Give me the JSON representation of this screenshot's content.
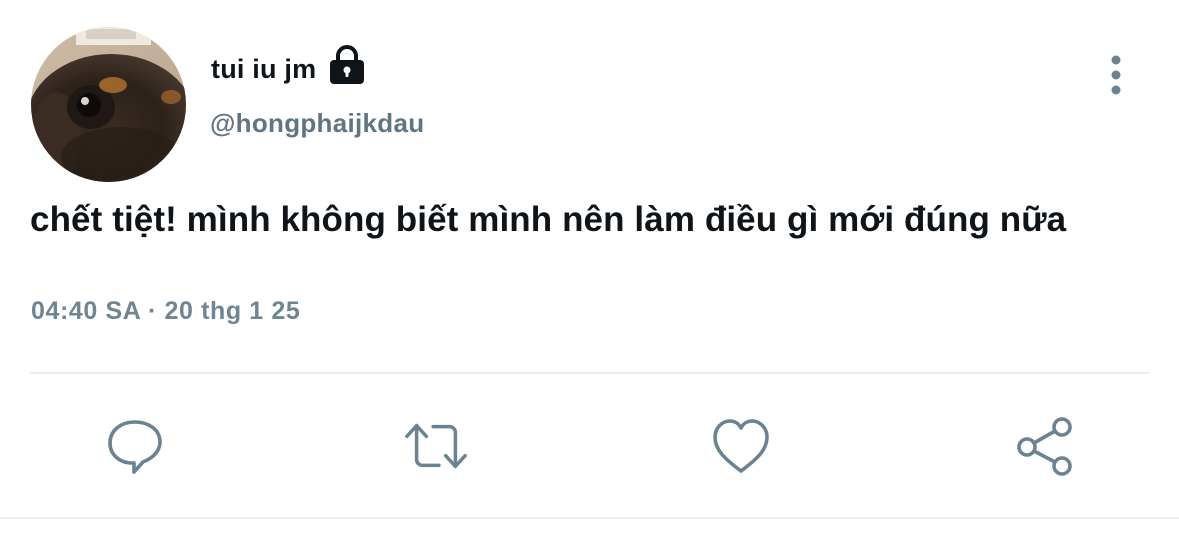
{
  "user": {
    "display_name": "tui iu jm",
    "handle": "@hongphaijkdau",
    "avatar_icon": "avatar-dog-photo",
    "locked_icon": "lock-icon"
  },
  "tweet": {
    "text": "chết tiệt! mình không biết mình nên làm điều gì mới đúng nữa",
    "time": "04:40 SA",
    "separator": "·",
    "date": "20 thg 1 25"
  },
  "actions": [
    {
      "name": "reply",
      "icon": "comment-icon"
    },
    {
      "name": "retweet",
      "icon": "retweet-icon"
    },
    {
      "name": "like",
      "icon": "heart-icon"
    },
    {
      "name": "share",
      "icon": "share-icon"
    }
  ],
  "menu_icon": "more-vertical-icon",
  "colors": {
    "text_primary": "#0f1419",
    "text_secondary": "#607584",
    "icon": "#6b8290",
    "divider": "#eceff1"
  }
}
